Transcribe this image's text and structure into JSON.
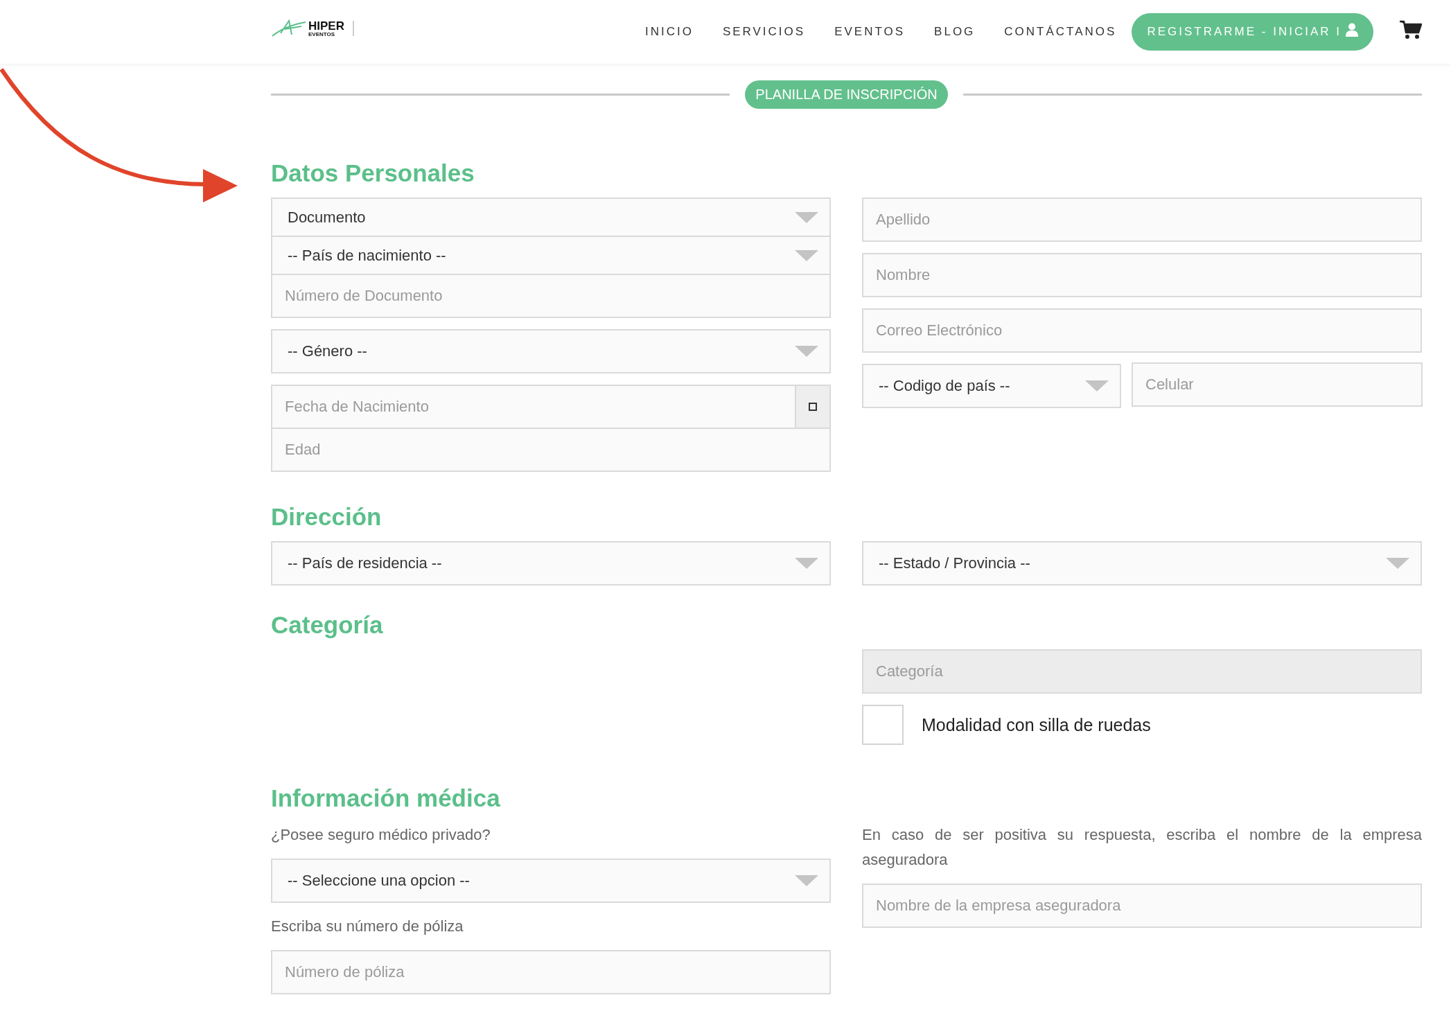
{
  "header": {
    "logo": {
      "title": "HIPER",
      "subtitle": "EVENTOS"
    },
    "nav": [
      {
        "label": "INICIO"
      },
      {
        "label": "SERVICIOS"
      },
      {
        "label": "EVENTOS"
      },
      {
        "label": "BLOG"
      },
      {
        "label": "CONTÁCTANOS"
      }
    ],
    "cta": "REGISTRARME - INICIAR I"
  },
  "banner": "PLANILLA DE INSCRIPCIÓN",
  "sections": [
    {
      "title": "Datos Personales",
      "left": [
        {
          "kind": "stack",
          "fields": [
            {
              "kind": "select",
              "value": "Documento"
            },
            {
              "kind": "select",
              "value": "-- País de nacimiento --"
            },
            {
              "kind": "input",
              "placeholder": "Número de Documento"
            }
          ]
        },
        {
          "kind": "stack",
          "fields": [
            {
              "kind": "select",
              "value": "-- Género --"
            }
          ]
        },
        {
          "kind": "stack",
          "fields": [
            {
              "kind": "date",
              "placeholder": "Fecha de Nacimiento"
            },
            {
              "kind": "input",
              "placeholder": "Edad"
            }
          ]
        }
      ],
      "right": [
        {
          "kind": "stack",
          "fields": [
            {
              "kind": "input",
              "placeholder": "Apellido"
            }
          ]
        },
        {
          "kind": "stack",
          "fields": [
            {
              "kind": "input",
              "placeholder": "Nombre"
            }
          ]
        },
        {
          "kind": "stack",
          "fields": [
            {
              "kind": "input",
              "placeholder": "Correo Electrónico"
            }
          ]
        },
        {
          "kind": "row",
          "fields": [
            {
              "kind": "select",
              "value": "-- Codigo de país --"
            },
            {
              "kind": "input",
              "placeholder": "Celular"
            }
          ]
        }
      ]
    },
    {
      "title": "Dirección",
      "left": [
        {
          "kind": "stack",
          "fields": [
            {
              "kind": "select",
              "value": "-- País de residencia --"
            }
          ]
        }
      ],
      "right": [
        {
          "kind": "stack",
          "fields": [
            {
              "kind": "select",
              "value": "-- Estado / Provincia --"
            }
          ]
        }
      ]
    },
    {
      "title": "Categoría",
      "right": [
        {
          "kind": "stack",
          "fields": [
            {
              "kind": "input",
              "placeholder": "Categoría",
              "disabled": true
            }
          ]
        },
        {
          "kind": "stack",
          "fields": [
            {
              "kind": "checkbox",
              "label": "Modalidad con silla de ruedas",
              "checked": false
            }
          ]
        }
      ]
    },
    {
      "title": "Información médica",
      "left": [
        {
          "kind": "stack",
          "fields": [
            {
              "kind": "label",
              "text": "¿Posee seguro médico privado?"
            }
          ]
        },
        {
          "kind": "stack",
          "fields": [
            {
              "kind": "select",
              "value": "-- Seleccione una opcion --"
            }
          ]
        },
        {
          "kind": "stack",
          "fields": [
            {
              "kind": "label",
              "text": "Escriba su número de póliza"
            }
          ]
        },
        {
          "kind": "stack",
          "fields": [
            {
              "kind": "input",
              "placeholder": "Número de póliza"
            }
          ]
        }
      ],
      "right": [
        {
          "kind": "stack",
          "fields": [
            {
              "kind": "label",
              "text": "En caso de ser positiva su respuesta, escriba el nombre de la empresa aseguradora"
            }
          ]
        },
        {
          "kind": "stack",
          "fields": [
            {
              "kind": "input",
              "placeholder": "Nombre de la empresa aseguradora"
            }
          ]
        }
      ]
    }
  ]
}
